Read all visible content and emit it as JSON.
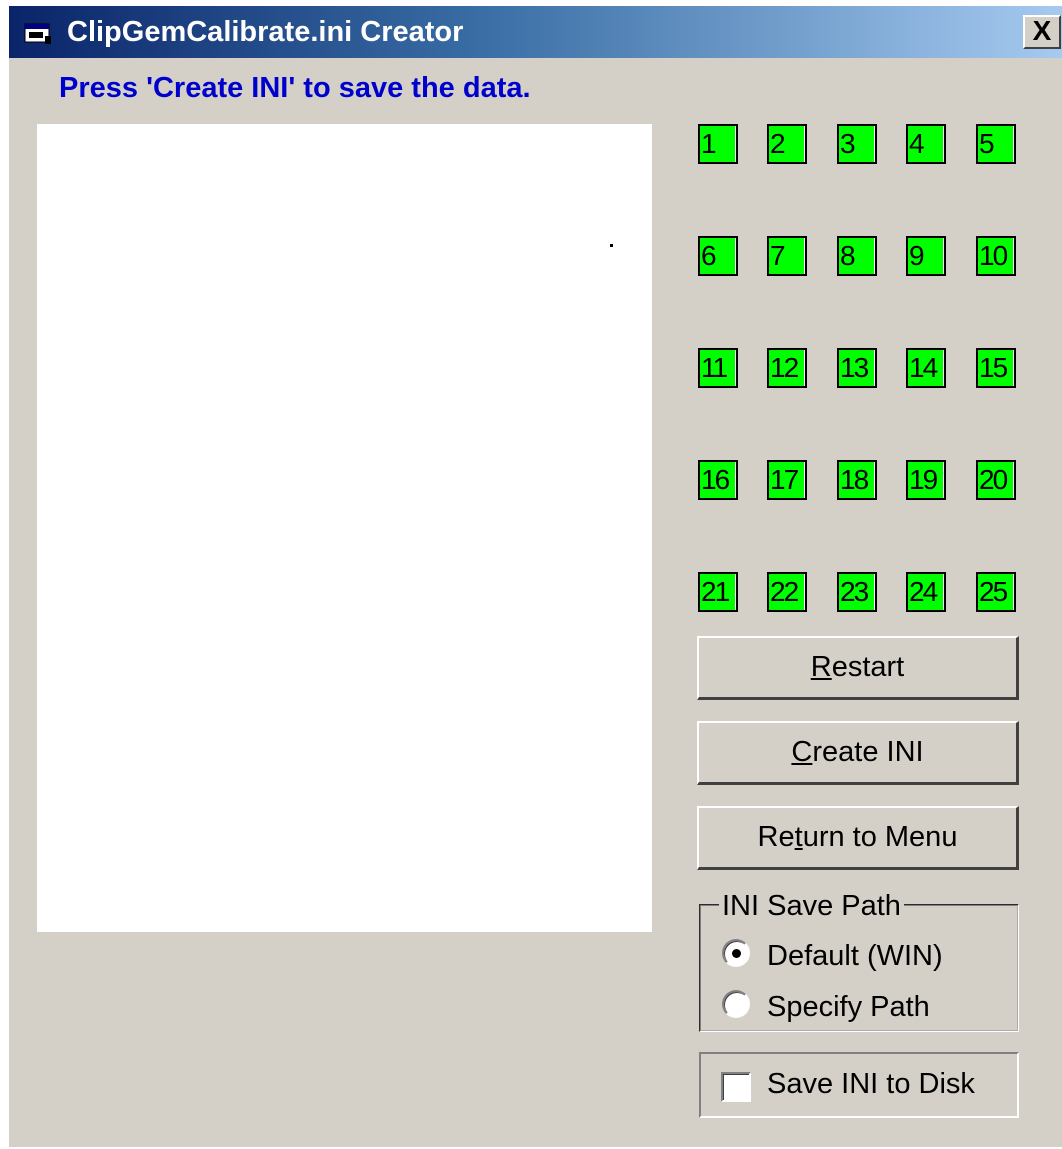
{
  "window": {
    "title": "ClipGemCalibrate.ini Creator",
    "close_label": "X"
  },
  "colors": {
    "title_gradient_start": "#0a246a",
    "title_gradient_end": "#a6caf0",
    "instruction_text": "#0000cc",
    "point_fill": "#00ff00",
    "window_face": "#d4d0c8"
  },
  "instruction": "Press 'Create INI' to save the data.",
  "points": [
    "1",
    "2",
    "3",
    "4",
    "5",
    "6",
    "7",
    "8",
    "9",
    "10",
    "11",
    "12",
    "13",
    "14",
    "15",
    "16",
    "17",
    "18",
    "19",
    "20",
    "21",
    "22",
    "23",
    "24",
    "25"
  ],
  "buttons": {
    "restart": {
      "mnemonic": "R",
      "rest": "estart"
    },
    "create": {
      "mnemonic": "C",
      "rest": "reate INI"
    },
    "return_menu": {
      "before": "Re",
      "mnemonic": "t",
      "rest": "urn to Menu"
    }
  },
  "save_path": {
    "group_label": "INI Save Path",
    "options": [
      {
        "label": "Default (WIN)",
        "selected": true
      },
      {
        "label": "Specify Path",
        "selected": false
      }
    ]
  },
  "save_to_disk": {
    "label": "Save INI to Disk",
    "checked": false
  }
}
